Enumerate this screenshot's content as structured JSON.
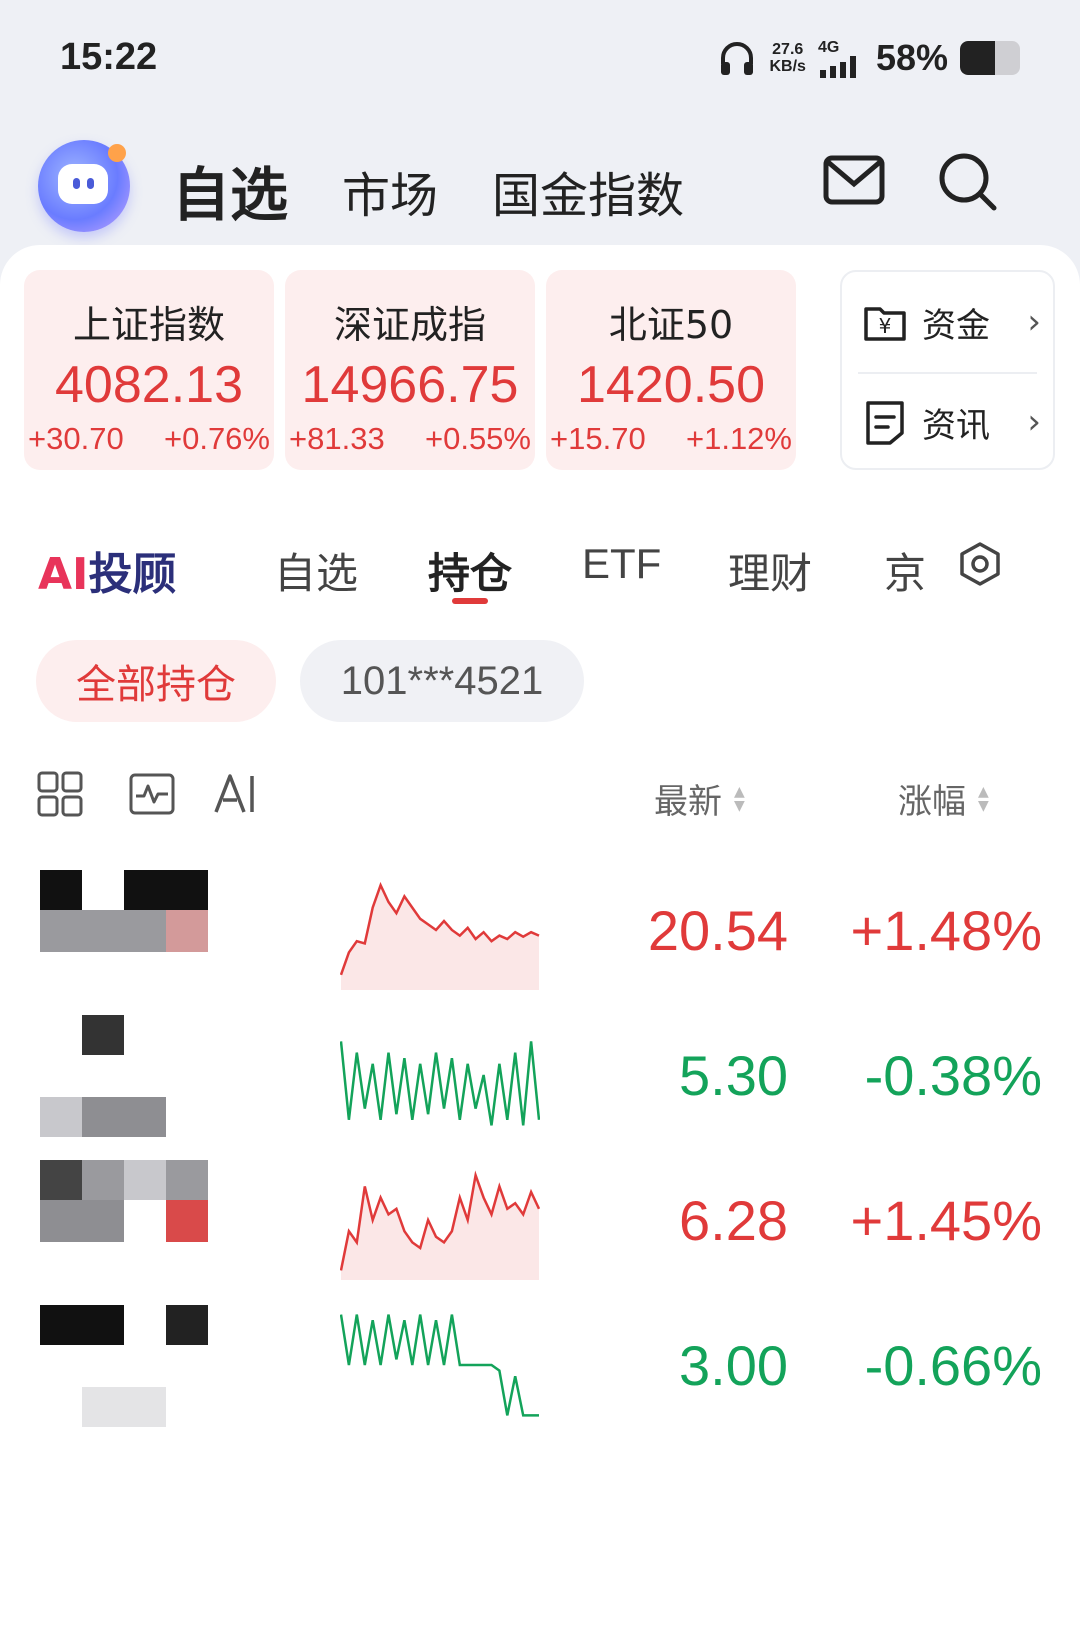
{
  "status_bar": {
    "time": "15:22",
    "net_speed_value": "27.6",
    "net_speed_unit": "KB/s",
    "network": "4G",
    "battery_percent": "58%",
    "battery_level": 0.58
  },
  "top_nav": {
    "tabs": [
      "自选",
      "市场",
      "国金指数"
    ],
    "active_tab": "自选",
    "icons": [
      "mail-icon",
      "search-icon"
    ]
  },
  "indices": [
    {
      "name": "上证指数",
      "value": "4082.13",
      "change": "+30.70",
      "change_pct": "+0.76%"
    },
    {
      "name": "深证成指",
      "value": "14966.75",
      "change": "+81.33",
      "change_pct": "+0.55%"
    },
    {
      "name": "北证50",
      "value": "1420.50",
      "change": "+15.70",
      "change_pct": "+1.12%"
    }
  ],
  "side_links": [
    {
      "label": "资金",
      "icon": "yuan-folder-icon"
    },
    {
      "label": "资讯",
      "icon": "news-doc-icon"
    }
  ],
  "sub_tabs": {
    "ai_logo_ai": "AI",
    "ai_logo_text": "投顾",
    "items": [
      "自选",
      "持仓",
      "ETF",
      "理财",
      "京"
    ],
    "active": "持仓",
    "settings_icon": "settings-hexagon-icon"
  },
  "filters": {
    "all_positions": "全部持仓",
    "account": "101***4521"
  },
  "toolbar": {
    "icons": [
      "grid-view-icon",
      "chart-view-icon",
      "ai-icon"
    ],
    "col_latest": "最新",
    "col_change": "涨幅"
  },
  "holdings": [
    {
      "price": "20.54",
      "change_pct": "+1.48%",
      "trend": "up",
      "spark": [
        0.9,
        0.7,
        0.6,
        0.62,
        0.3,
        0.1,
        0.25,
        0.35,
        0.2,
        0.3,
        0.4,
        0.45,
        0.5,
        0.42,
        0.5,
        0.55,
        0.48,
        0.58,
        0.52,
        0.6,
        0.55,
        0.58,
        0.52,
        0.56,
        0.52,
        0.55
      ]
    },
    {
      "price": "5.30",
      "change_pct": "-0.38%",
      "trend": "down",
      "spark": [
        0.2,
        0.9,
        0.3,
        0.8,
        0.4,
        0.9,
        0.3,
        0.85,
        0.35,
        0.9,
        0.4,
        0.85,
        0.3,
        0.8,
        0.35,
        0.9,
        0.4,
        0.8,
        0.5,
        0.95,
        0.4,
        0.9,
        0.3,
        0.95,
        0.2,
        0.9
      ]
    },
    {
      "price": "6.28",
      "change_pct": "+1.45%",
      "trend": "up",
      "spark": [
        0.95,
        0.6,
        0.7,
        0.2,
        0.5,
        0.3,
        0.45,
        0.4,
        0.6,
        0.7,
        0.75,
        0.5,
        0.65,
        0.7,
        0.6,
        0.3,
        0.5,
        0.1,
        0.3,
        0.45,
        0.2,
        0.4,
        0.35,
        0.45,
        0.25,
        0.4
      ]
    },
    {
      "price": "3.00",
      "change_pct": "-0.66%",
      "trend": "down",
      "spark": [
        0.05,
        0.5,
        0.05,
        0.5,
        0.1,
        0.5,
        0.05,
        0.45,
        0.1,
        0.5,
        0.05,
        0.5,
        0.1,
        0.5,
        0.05,
        0.5,
        0.5,
        0.5,
        0.5,
        0.5,
        0.55,
        0.95,
        0.6,
        0.95,
        0.95,
        0.95
      ]
    }
  ]
}
